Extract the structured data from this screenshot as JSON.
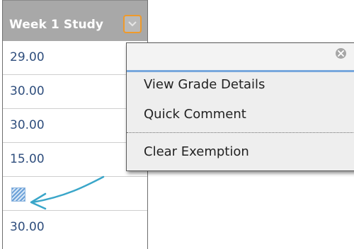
{
  "column": {
    "header_title": "Week 1 Study",
    "menu_button_icon": "chevron-down-icon"
  },
  "cells": [
    {
      "value": "29.00"
    },
    {
      "value": "30.00"
    },
    {
      "value": "30.00"
    },
    {
      "value": "15.00"
    },
    {
      "value": "",
      "icon": "exempt-grade-icon"
    },
    {
      "value": "30.00"
    }
  ],
  "context_menu": {
    "close_icon": "close-icon",
    "items": [
      {
        "label": "View Grade Details"
      },
      {
        "label": "Quick Comment"
      },
      {
        "label": "Clear Exemption"
      }
    ]
  },
  "colors": {
    "header_bg": "#a8a8a8",
    "menu_button_border": "#ef9a2b",
    "value_text": "#2f4e7d",
    "menu_accent": "#78a7dd",
    "arrow": "#3aa6c9"
  }
}
